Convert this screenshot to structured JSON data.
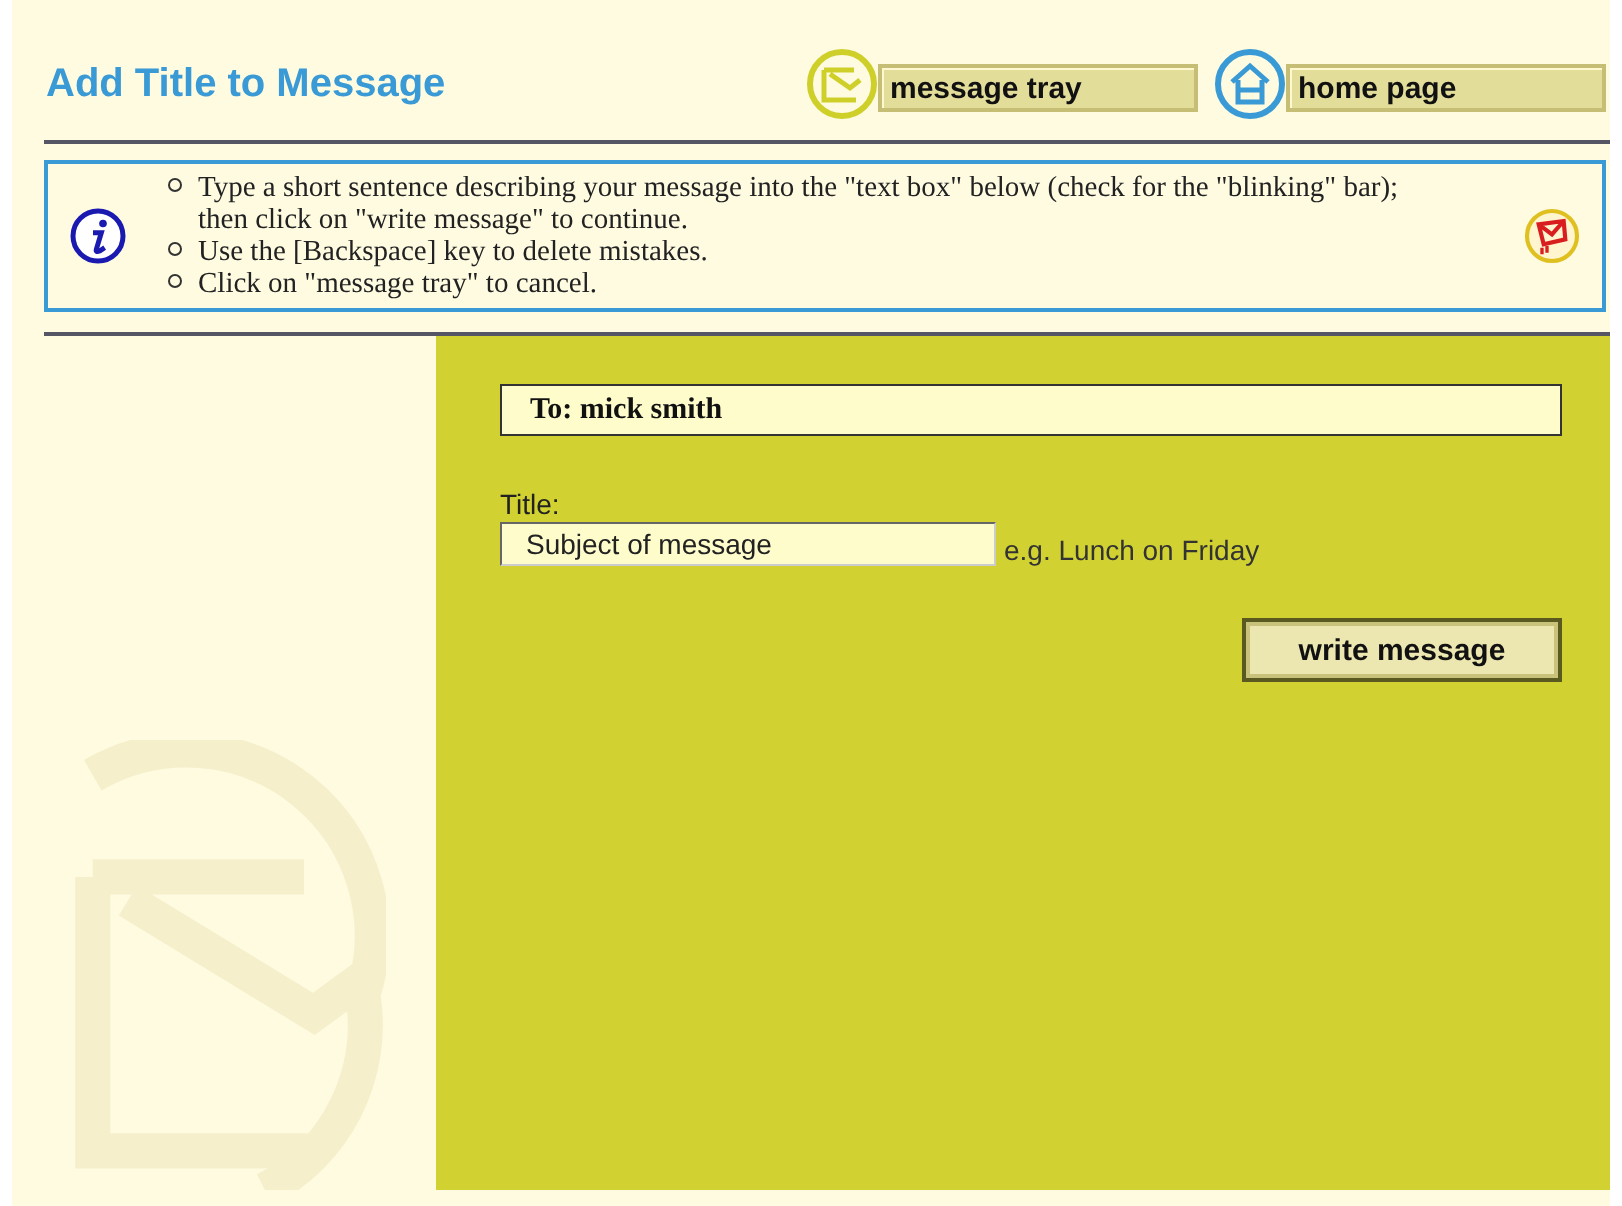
{
  "page_title": "Add Title to Message",
  "nav_buttons": [
    {
      "label": "message tray",
      "kind": "tray"
    },
    {
      "label": "home page",
      "kind": "home"
    }
  ],
  "instructions": [
    "Type a short sentence describing your message into the \"text box\" below (check for the \"blinking\" bar); then click on \"write message\" to continue.",
    "Use the [Backspace] key to delete mistakes.",
    "Click on \"message tray\" to cancel."
  ],
  "recipient": "To: mick smith",
  "title_field": {
    "label": "Title:",
    "value": "Subject of message",
    "hint": "e.g. Lunch on Friday"
  },
  "write_button": "write message"
}
